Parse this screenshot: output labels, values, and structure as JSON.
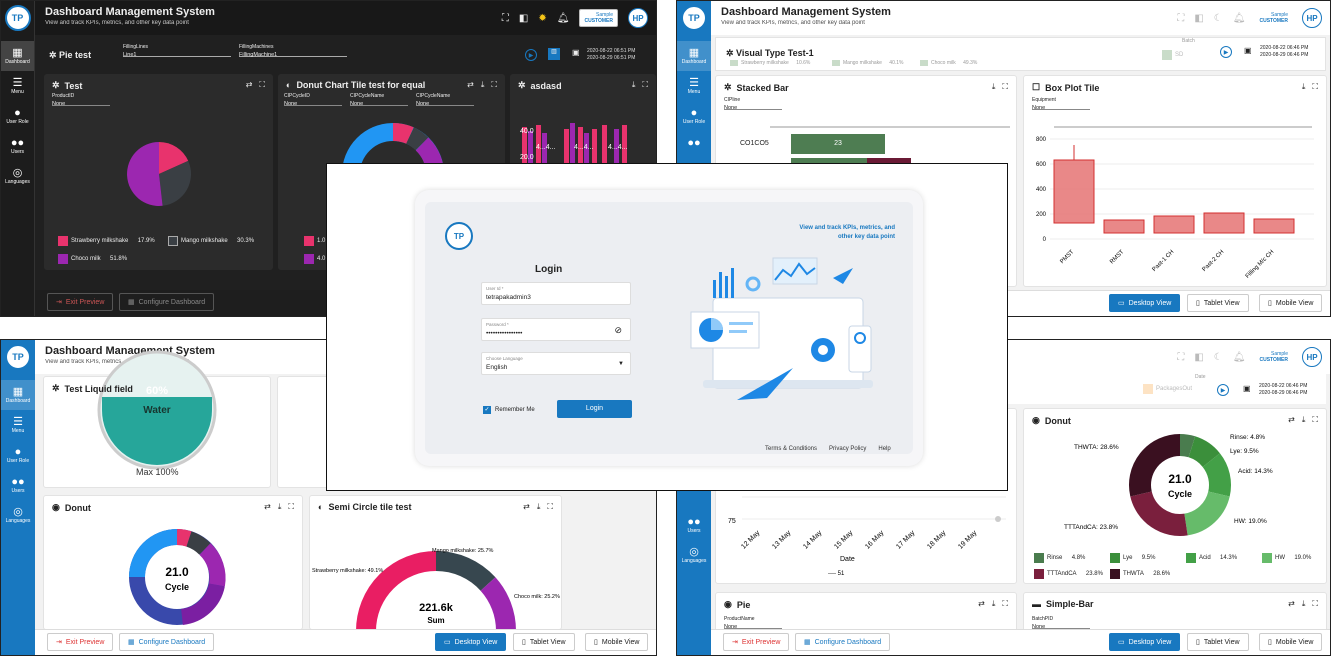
{
  "app": {
    "title": "Dashboard Management System",
    "subtitle": "View and track KPIs, metrics, and other key data point",
    "customer_top": "Sample",
    "customer_bottom": "CUSTOMER",
    "avatar": "HP"
  },
  "sidebar": [
    {
      "icon": "dashboard-icon",
      "label": "Dashboard"
    },
    {
      "icon": "menu-icon",
      "label": "Menu"
    },
    {
      "icon": "user-role-icon",
      "label": "User Role"
    },
    {
      "icon": "users-icon",
      "label": "Users"
    },
    {
      "icon": "languages-icon",
      "label": "Languages"
    }
  ],
  "p1": {
    "dashboard_name": "Pie test",
    "filter1_label": "FillingLines",
    "filter1_value": "Line1",
    "filter2_label": "FillingMachines",
    "filter2_value": "FillingMachine1",
    "date_from": "2020-08-22 06:51 PM",
    "date_to": "2020-08-29 06:51 PM",
    "card1": {
      "title": "Test",
      "sel_label": "ProductID",
      "sel_value": "None",
      "legend": [
        {
          "label": "Strawberry milkshake",
          "value": "17.9%",
          "color": "#e8336d"
        },
        {
          "label": "Mango milkshake",
          "value": "30.3%",
          "color": "#3a3f44"
        },
        {
          "label": "Choco milk",
          "value": "51.8%",
          "color": "#9c27b0"
        }
      ]
    },
    "card2": {
      "title": "Donut Chart Tile test for equal",
      "sel1_label": "CIPCycleID",
      "sel1_value": "None",
      "sel2_label": "CIPCycleName",
      "sel2_value": "None",
      "sel3_label": "CIPCycleName",
      "sel3_value": "None",
      "leg1": "1.0",
      "leg2": "4.0"
    },
    "card3": {
      "title": "asdasd",
      "labels": [
        "40.0",
        "4...4...",
        "20.0",
        "4...4...",
        "4...4..."
      ]
    },
    "exit": "Exit Preview",
    "configure": "Configure Dashboard"
  },
  "p2": {
    "section_title": "Visual Type Test-1",
    "legend": [
      {
        "label": "Strawberry milkshake",
        "value": "10.6%"
      },
      {
        "label": "Mango milkshake",
        "value": "40.1%"
      },
      {
        "label": "Choco milk",
        "value": "49.3%"
      }
    ],
    "batch": "Batch",
    "sd": "SD",
    "date_from": "2020-08-22 06:46 PM",
    "date_to": "2020-08-29 06:46 PM",
    "card1": {
      "title": "Stacked Bar",
      "sel_label": "CIPline",
      "sel_value": "None",
      "row_label": "CO1CO5",
      "bar_value": "23"
    },
    "card2": {
      "title": "Box Plot Tile",
      "sel_label": "Equipment",
      "sel_value": "None",
      "y_ticks": [
        "800",
        "600",
        "400",
        "200",
        "0"
      ],
      "x_labels": [
        "PMST",
        "RMST",
        "Past-1 CH",
        "Past-2 CH",
        "Filling M/c CH"
      ]
    },
    "views": [
      "Desktop View",
      "Tablet View",
      "Mobile View"
    ]
  },
  "p3": {
    "card_liquid": {
      "title": "Test Liquid field",
      "percent": "60%",
      "name": "Water",
      "max": "Max 100%"
    },
    "card_donut": {
      "title": "Donut",
      "value": "21.0",
      "label": "Cycle"
    },
    "card_semi": {
      "title": "Semi Circle tile test",
      "value": "221.6k",
      "label": "Sum",
      "l1": "Mango milkshake: 25.7%",
      "l2": "Strawberry milkshake: 49.1%",
      "l3": "Choco milk: 25.2%"
    },
    "exit": "Exit Preview",
    "configure": "Configure Dashboard",
    "views": [
      "Desktop View",
      "Tablet View",
      "Mobile View"
    ]
  },
  "p4": {
    "packages": "PackagesOut",
    "date": "Date",
    "date_from": "2020-08-22 06:46 PM",
    "date_to": "2020-08-29 06:46 PM",
    "line": {
      "y_tick": "75",
      "x_labels": [
        "12 May",
        "13 May",
        "14 May",
        "15 May",
        "16 May",
        "17 May",
        "18 May",
        "19 May"
      ],
      "xlabel": "Date",
      "legend": "51"
    },
    "card_donut": {
      "title": "Donut",
      "value": "21.0",
      "label": "Cycle",
      "labels": [
        "Rinse: 4.8%",
        "Lye: 9.5%",
        "Acid: 14.3%",
        "HW: 19.0%",
        "TTTAndCA: 23.8%",
        "THWTA: 28.6%"
      ],
      "legend": [
        {
          "label": "Rinse",
          "value": "4.8%",
          "color": "#4a7c4e"
        },
        {
          "label": "Lye",
          "value": "9.5%",
          "color": "#3b8f3b"
        },
        {
          "label": "Acid",
          "value": "14.3%",
          "color": "#43a047"
        },
        {
          "label": "HW",
          "value": "19.0%",
          "color": "#66bb6a"
        },
        {
          "label": "TTTAndCA",
          "value": "23.8%",
          "color": "#7a1f3d"
        },
        {
          "label": "THWTA",
          "value": "28.6%",
          "color": "#3a1020"
        }
      ]
    },
    "card_pie": {
      "title": "Pie",
      "sel_label": "ProductName",
      "sel_value": "None"
    },
    "card_bar": {
      "title": "Simple-Bar",
      "sel_label": "BatchPID",
      "sel_value": "None"
    },
    "exit": "Exit Preview",
    "configure": "Configure Dashboard",
    "views": [
      "Desktop View",
      "Tablet View",
      "Mobile View"
    ]
  },
  "login": {
    "title": "Login",
    "user_label": "User Id *",
    "user_value": "tetrapakadmin3",
    "pwd_label": "Password *",
    "pwd_value": "••••••••••••••••",
    "lang_label": "Choose Language",
    "lang_value": "English",
    "remember": "Remember Me",
    "button": "Login",
    "tagline": "View and track KPIs, metrics, and other key data point",
    "links": [
      "Terms & Conditions",
      "Privacy Policy",
      "Help"
    ]
  }
}
